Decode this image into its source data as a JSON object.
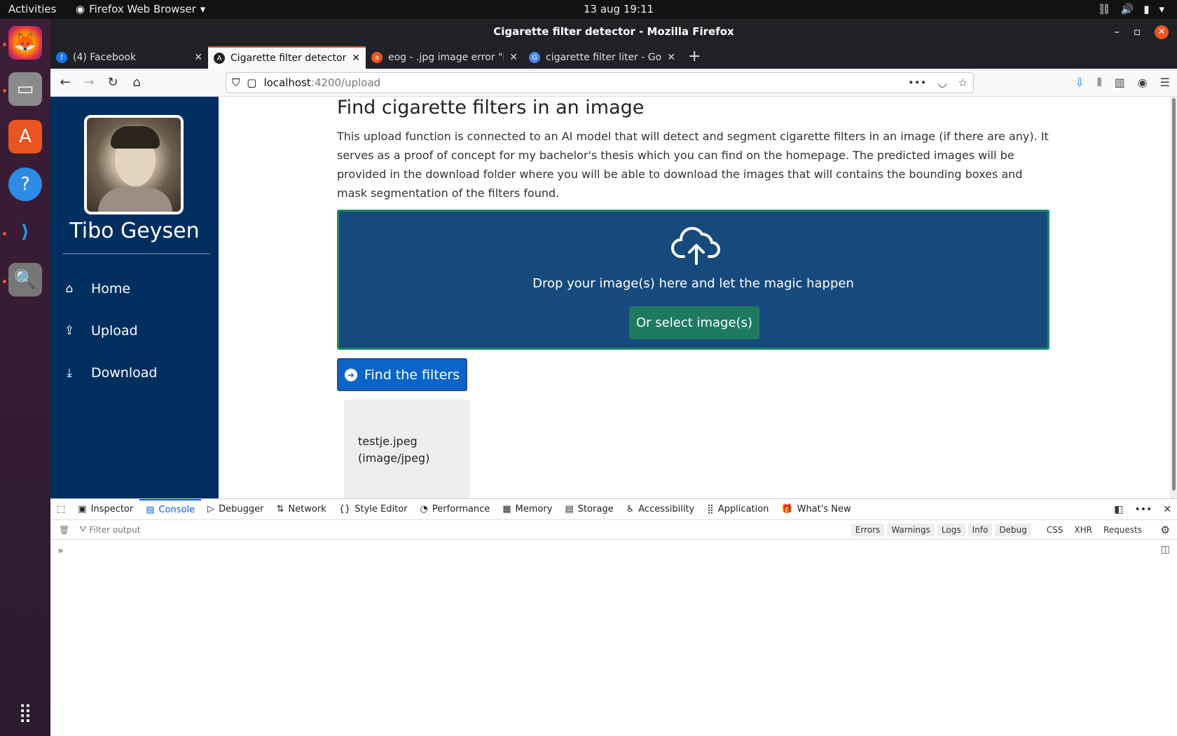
{
  "system": {
    "activities": "Activities",
    "app_name": "Firefox Web Browser",
    "clock": "13 aug  19:11"
  },
  "window": {
    "title": "Cigarette filter detector - Mozilla Firefox"
  },
  "tabs": [
    {
      "label": "(4) Facebook",
      "favicon": "facebook-icon",
      "color": "#1877f2"
    },
    {
      "label": "Cigarette filter detector",
      "favicon": "angular-icon",
      "color": "#222"
    },
    {
      "label": "eog - .jpg image error \"Er",
      "favicon": "askubuntu-icon",
      "color": "#e95420"
    },
    {
      "label": "cigarette filter liter - Goo",
      "favicon": "google-icon",
      "color": "#4285f4"
    }
  ],
  "url": {
    "host": "localhost",
    "path": ":4200/upload"
  },
  "sidebar": {
    "name": "Tibo Geysen",
    "items": [
      {
        "label": "Home",
        "icon": "home-icon"
      },
      {
        "label": "Upload",
        "icon": "upload-icon"
      },
      {
        "label": "Download",
        "icon": "download-icon"
      }
    ]
  },
  "main": {
    "title": "Find cigarette filters in an image",
    "description": "This upload function is connected to an AI model that will detect and segment cigarette filters in an image (if there are any). It serves as a proof of concept for my bachelor's thesis which you can find on the homepage. The predicted images will be provided in the download folder where you will be able to download the images that will contains the bounding boxes and mask segmentation of the filters found.",
    "drop_text": "Drop your image(s) here and let the magic happen",
    "select_label": "Or select image(s)",
    "find_label": "Find the filters",
    "file_name": "testje.jpeg",
    "file_type": "(image/jpeg)"
  },
  "devtools": {
    "tabs": [
      "Inspector",
      "Console",
      "Debugger",
      "Network",
      "Style Editor",
      "Performance",
      "Memory",
      "Storage",
      "Accessibility",
      "Application",
      "What's New"
    ],
    "filter_placeholder": "Filter output",
    "levels": [
      "Errors",
      "Warnings",
      "Logs",
      "Info",
      "Debug"
    ],
    "extras": [
      "CSS",
      "XHR",
      "Requests"
    ],
    "prompt": "»"
  },
  "colors": {
    "sidebar_bg": "#002f5f",
    "dropzone_bg": "#174a7c",
    "select_btn": "#1d7a5f",
    "find_btn": "#0b65c9",
    "ubuntu_orange": "#e95420"
  }
}
